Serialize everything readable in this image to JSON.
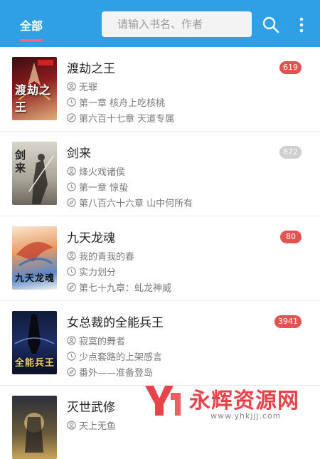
{
  "header": {
    "tab_label": "全部",
    "search_placeholder": "请输入书名、作者"
  },
  "books": [
    {
      "title": "渡劫之王",
      "author": "无罪",
      "first_chapter": "第一章 核舟上吃核桃",
      "latest_chapter": "第六百十七章 天道专属",
      "badge": "619",
      "badge_color": "#e15452",
      "cover_text": "渡劫之王"
    },
    {
      "title": "剑来",
      "author": "烽火戏诸侯",
      "first_chapter": "第一章 惊蛰",
      "latest_chapter": "第八百六十六章 山中何所有",
      "badge": "872",
      "badge_color": "#cfcfcf",
      "cover_text": "剑来"
    },
    {
      "title": "九天龙魂",
      "author": "我的青我的春",
      "first_chapter": "实力划分",
      "latest_chapter": "第七十九章：虬龙神威",
      "badge": "80",
      "badge_color": "#e15452",
      "cover_text": "九天龙魂"
    },
    {
      "title": "女总裁的全能兵王",
      "author": "寂寞的舞者",
      "first_chapter": "少点套路的上架感言",
      "latest_chapter": "番外——准备登岛",
      "badge": "3941",
      "badge_color": "#e15452",
      "cover_text": "全能兵王"
    },
    {
      "title": "灭世武修",
      "author": "天上无鱼"
    }
  ],
  "watermark": {
    "name": "永辉资源网",
    "url": "www.yhkjjj.com"
  }
}
